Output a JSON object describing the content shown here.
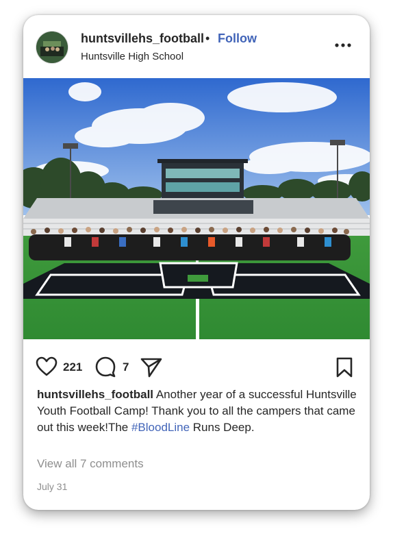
{
  "post": {
    "username": "huntsvillehs_football",
    "separator": "•",
    "follow_label": "Follow",
    "location": "Huntsville High School",
    "more_icon": "more-horizontal-icon",
    "image": {
      "sky_color": "#3f78d8",
      "grass_color": "#3c9a3e",
      "logo_color": "#15191f"
    },
    "actions": {
      "like_icon": "heart-icon",
      "like_count": "221",
      "comment_icon": "comment-icon",
      "comment_count": "7",
      "share_icon": "share-icon",
      "save_icon": "bookmark-icon"
    },
    "caption": {
      "user": "huntsvillehs_football",
      "text_before": " Another year of a successful Huntsville Youth Football Camp! Thank you to all the campers that came out this week!The ",
      "hashtag": "#BloodLine",
      "text_after": " Runs Deep."
    },
    "view_comments": "View all 7 comments",
    "date": "July 31",
    "accent_color": "#4164b8"
  }
}
